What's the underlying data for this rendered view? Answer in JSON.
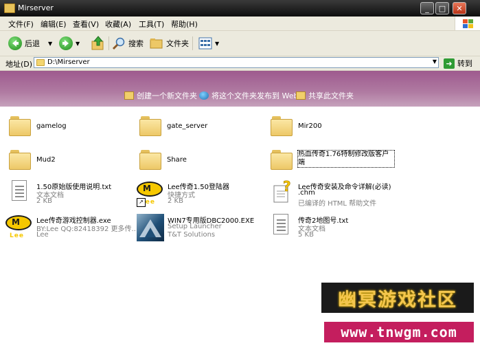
{
  "window": {
    "title": "Mirserver",
    "min_label": "_",
    "max_label": "□",
    "close_label": "✕"
  },
  "menu": [
    "文件(F)",
    "编辑(E)",
    "查看(V)",
    "收藏(A)",
    "工具(T)",
    "帮助(H)"
  ],
  "toolbar": {
    "back_label": "后退",
    "search_label": "搜索",
    "folders_label": "文件夹"
  },
  "address": {
    "label": "地址(D)",
    "value": "D:\\Mirserver",
    "go_label": "转到"
  },
  "tasks": [
    {
      "label": "创建一个新文件夹",
      "icon": "new-folder-icon"
    },
    {
      "label": "将这个文件夹发布到 Web",
      "icon": "globe-icon"
    },
    {
      "label": "共享此文件夹",
      "icon": "share-icon"
    }
  ],
  "folders": [
    {
      "name": "gamelog"
    },
    {
      "name": "gate_server"
    },
    {
      "name": "Mir200"
    },
    {
      "name": "Mud2"
    },
    {
      "name": "Share"
    },
    {
      "name": "热血传奇1.76特制修改版客户端"
    }
  ],
  "files": [
    {
      "name": "1.50原始版使用说明.txt",
      "line1": "文本文档",
      "line2": "2 KB",
      "icon": "text-document-icon"
    },
    {
      "name": "Lee传奇1.50登陆器",
      "line1": "快捷方式",
      "line2": "2 KB",
      "icon": "lee-logo-shortcut-icon"
    },
    {
      "name": "Lee传奇安装及命令详解(必读)",
      "name2": ".chm",
      "line1": "已编译的 HTML 帮助文件",
      "icon": "chm-help-icon"
    },
    {
      "name": "Lee传奇游戏控制器.exe",
      "line1": "BY:Lee QQ:82418392 更多传...",
      "line2": "Lee",
      "icon": "lee-logo-icon"
    },
    {
      "name": "WIN7专用版DBC2000.EXE",
      "line1": "Setup Launcher",
      "line2": "T&T Solutions",
      "icon": "setup-launcher-icon"
    },
    {
      "name": "传奇2地图号.txt",
      "line1": "文本文档",
      "line2": "5 KB",
      "icon": "text-document-icon"
    }
  ],
  "watermark": {
    "line1": "幽冥游戏社区",
    "line2": "www.tnwgm.com"
  },
  "colors": {
    "banner": "#a8679a",
    "titlebar": "#1a1a1a",
    "folder": "#f0cc6c"
  }
}
